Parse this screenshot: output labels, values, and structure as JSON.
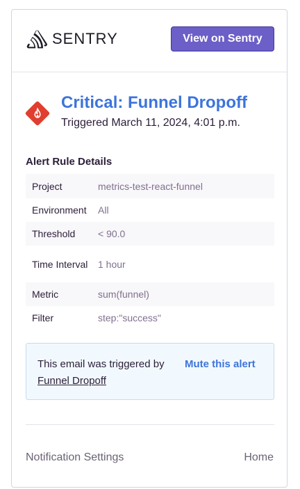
{
  "header": {
    "logo_text": "SENTRY",
    "logo_icon": "sentry-logo-icon",
    "view_button_label": "View on Sentry"
  },
  "alert": {
    "title": "Critical: Funnel Dropoff",
    "triggered": "Triggered March 11, 2024, 4:01 p.m.",
    "severity_icon": "fire-icon",
    "severity_color": "#e03e2f"
  },
  "details": {
    "title": "Alert Rule Details",
    "rows": [
      {
        "label": "Project",
        "value": "metrics-test-react-funnel"
      },
      {
        "label": "Environment",
        "value": "All"
      },
      {
        "label": "Threshold",
        "value": "< 90.0"
      },
      {
        "label": "Time Interval",
        "value": "1 hour"
      },
      {
        "label": "Metric",
        "value": "sum(funnel)"
      },
      {
        "label": "Filter",
        "value": "step:\"success\""
      }
    ]
  },
  "info": {
    "text": "This email was triggered by",
    "rule_link": "Funnel Dropoff",
    "mute_link": "Mute this alert"
  },
  "footer": {
    "settings_link": "Notification Settings",
    "home_link": "Home"
  },
  "colors": {
    "accent": "#6c5fc7",
    "link": "#3d74db"
  }
}
